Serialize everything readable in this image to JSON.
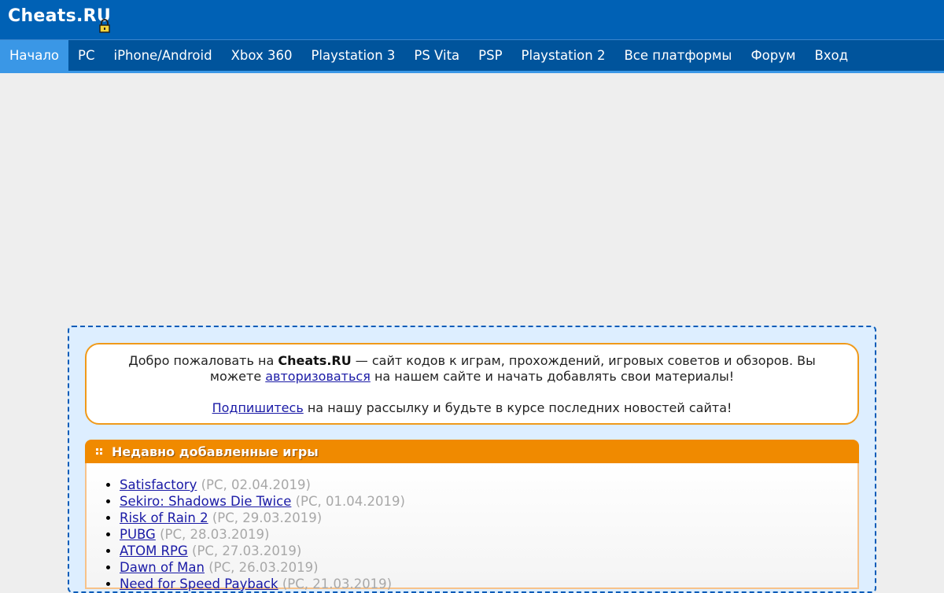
{
  "header": {
    "logo": "Cheats.RU"
  },
  "nav": {
    "items": [
      {
        "label": "Начало",
        "active": true
      },
      {
        "label": "PC"
      },
      {
        "label": "iPhone/Android"
      },
      {
        "label": "Xbox 360"
      },
      {
        "label": "Playstation 3"
      },
      {
        "label": "PS Vita"
      },
      {
        "label": "PSP"
      },
      {
        "label": "Playstation 2"
      },
      {
        "label": "Все платформы"
      },
      {
        "label": "Форум"
      },
      {
        "label": "Вход"
      }
    ]
  },
  "welcome": {
    "intro": "Добро пожаловать на ",
    "site_name": "Cheats.RU",
    "rest": " — сайт кодов к играм, прохождений, игровых советов и обзоров. Вы можете ",
    "auth_link": "авторизоваться",
    "auth_rest": " на нашем сайте и начать добавлять свои материалы!",
    "subscribe_link": "Подпишитесь",
    "subscribe_rest": " на нашу рассылку и будьте в курсе последних новостей сайта!"
  },
  "recent": {
    "title": "Недавно добавленные игры",
    "games": [
      {
        "name": "Satisfactory",
        "meta": "(PC, 02.04.2019)"
      },
      {
        "name": "Sekiro: Shadows Die Twice",
        "meta": "(PC, 01.04.2019)"
      },
      {
        "name": "Risk of Rain 2",
        "meta": "(PC, 29.03.2019)"
      },
      {
        "name": "PUBG",
        "meta": "(PC, 28.03.2019)"
      },
      {
        "name": "ATOM RPG",
        "meta": "(PC, 27.03.2019)"
      },
      {
        "name": "Dawn of Man",
        "meta": "(PC, 26.03.2019)"
      },
      {
        "name": "Need for Speed Payback",
        "meta": "(PC, 21.03.2019)"
      }
    ]
  },
  "colors": {
    "header_bg": "#0061b5",
    "nav_bg": "#00549c",
    "nav_active": "#3a97e6",
    "frame_border": "#0a5cb8",
    "accent_orange": "#f08a00",
    "link": "#1a1aa6"
  },
  "icons": {
    "logo_badge": "lock-icon",
    "panel_bullet": "bullet-icon"
  }
}
